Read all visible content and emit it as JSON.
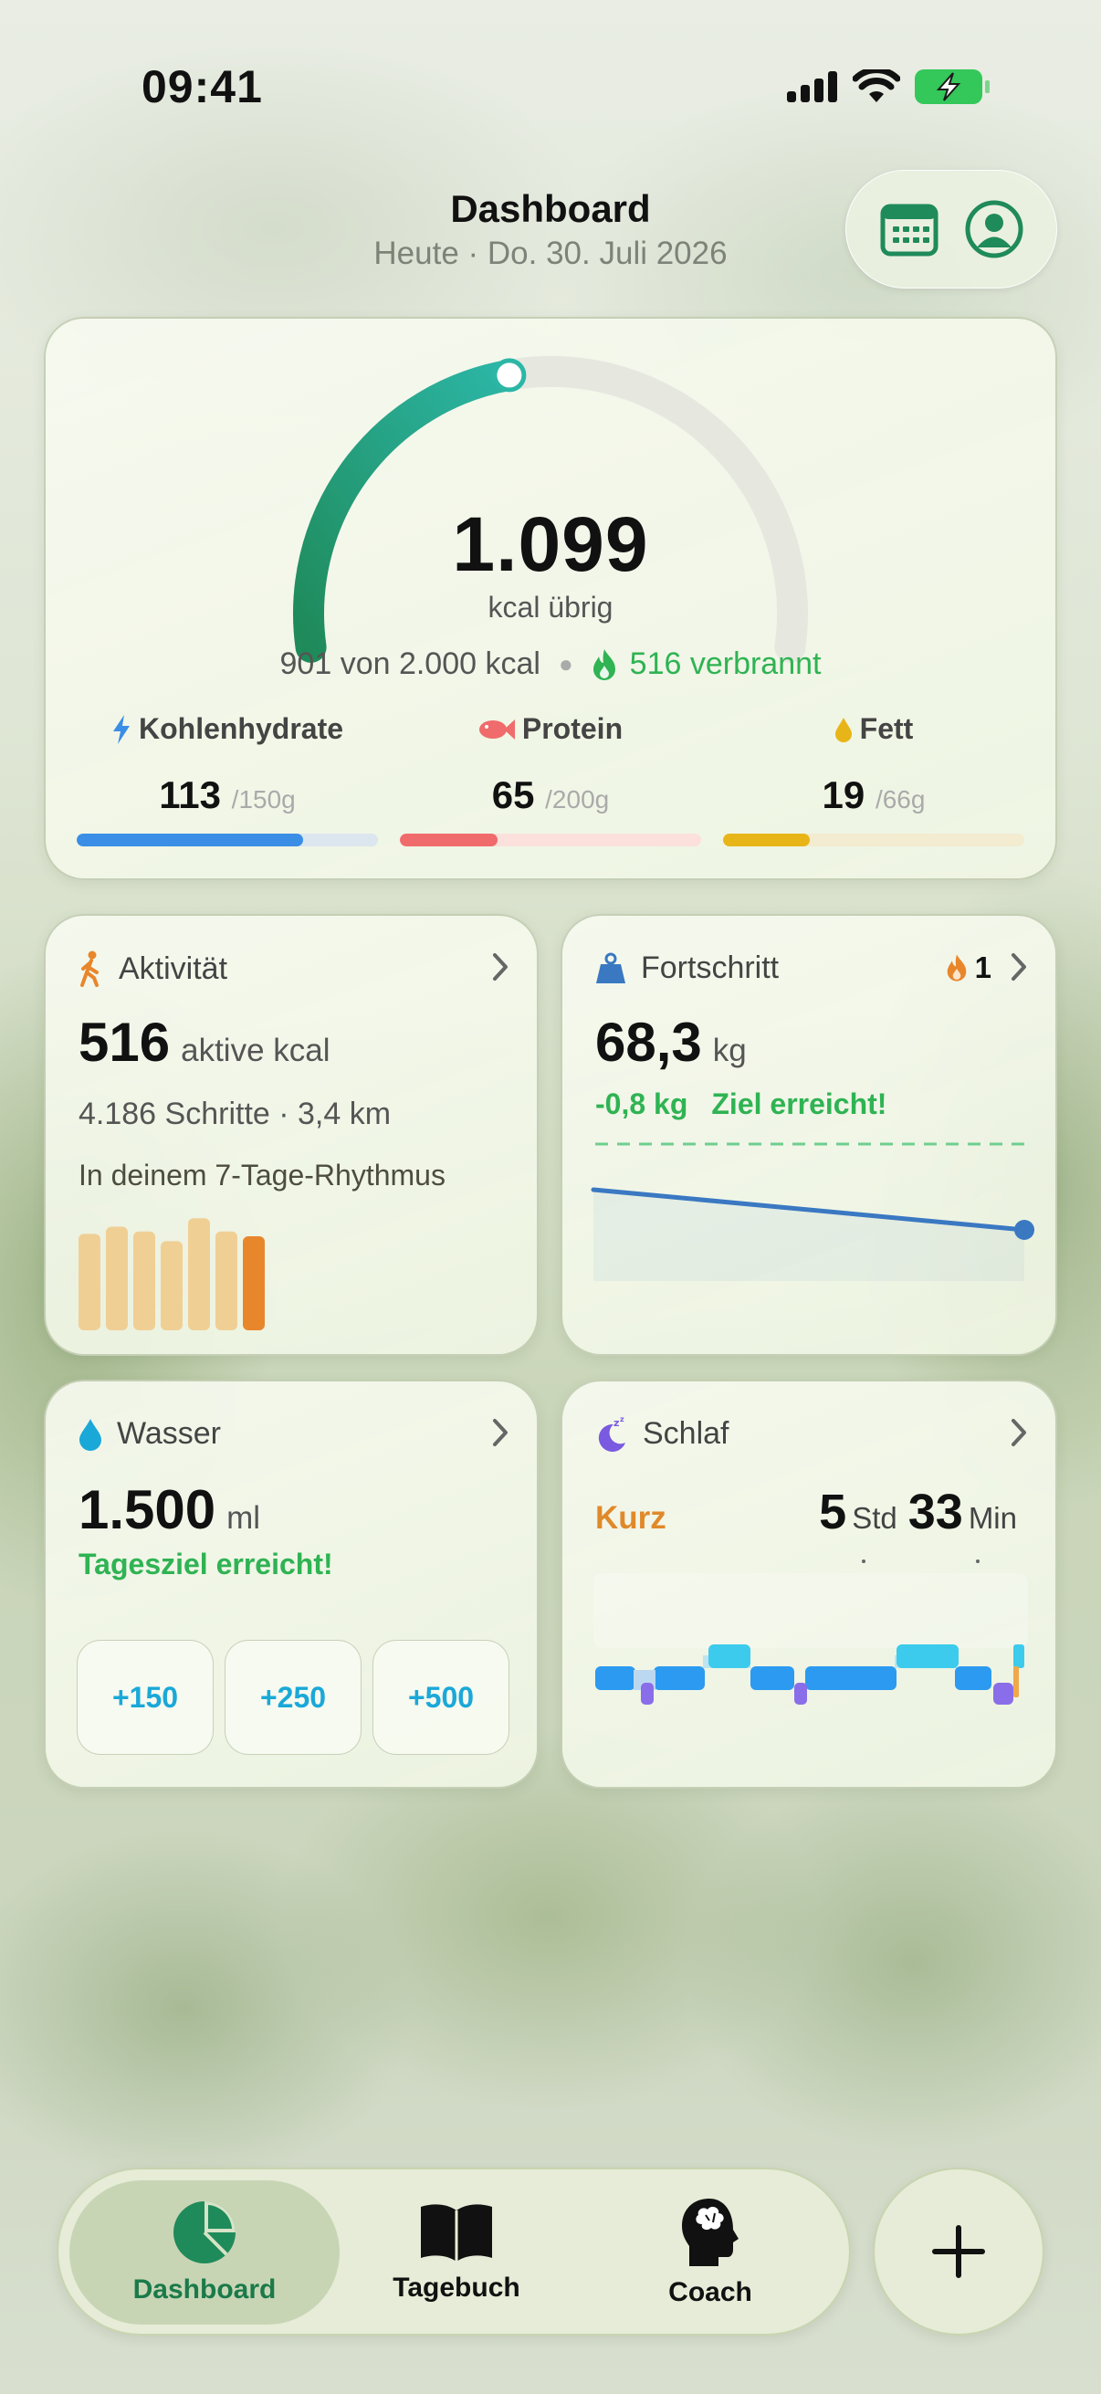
{
  "status_bar": {
    "time": "09:41"
  },
  "header": {
    "title": "Dashboard",
    "subtitle": "Heute · Do. 30. Juli 2026",
    "calendar_icon": "calendar-icon",
    "profile_icon": "profile-icon"
  },
  "calories": {
    "remaining": "1.099",
    "remaining_label": "kcal übrig",
    "consumed_text": "901 von 2.000 kcal",
    "burned_text": "516 verbrannt",
    "progress_fraction": 0.45,
    "colors": {
      "arc_start": "#1f8a5a",
      "arc_end": "#2cb6a6",
      "track": "#e6e8e0"
    }
  },
  "macros": [
    {
      "label": "Kohlenhydrate",
      "value": "113",
      "max": "/150g",
      "fraction": 0.75,
      "color": "#3a8ee6",
      "track": "#dbe6ee",
      "icon": "lightning-icon"
    },
    {
      "label": "Protein",
      "value": "65",
      "max": "/200g",
      "fraction": 0.325,
      "color": "#f06b6b",
      "track": "#fbe0dc",
      "icon": "fish-icon"
    },
    {
      "label": "Fett",
      "value": "19",
      "max": "/66g",
      "fraction": 0.288,
      "color": "#e8b518",
      "track": "#f3ecd0",
      "icon": "drop-icon"
    }
  ],
  "activity": {
    "title": "Aktivität",
    "value": "516",
    "unit": "aktive kcal",
    "steps": "4.186 Schritte · 3,4 km",
    "rhythm": "In deinem 7-Tage-Rhythmus",
    "bars": [
      0.8,
      0.86,
      0.82,
      0.74,
      0.93,
      0.82,
      0.78
    ],
    "colors": {
      "past": "#f0cf95",
      "today": "#e8862c"
    }
  },
  "progress": {
    "title": "Fortschritt",
    "streak": "1",
    "value": "68,3",
    "unit": "kg",
    "delta": "-0,8 kg",
    "goal_text": "Ziel erreicht!",
    "line_color": "#3a78c2"
  },
  "water": {
    "title": "Wasser",
    "value": "1.500",
    "unit": "ml",
    "goal_text": "Tagesziel erreicht!",
    "buttons": [
      "+150",
      "+250",
      "+500"
    ]
  },
  "sleep": {
    "title": "Schlaf",
    "quality": "Kurz",
    "hours": "5",
    "hours_unit": "Std",
    "minutes": "33",
    "minutes_unit": "Min",
    "colors": {
      "core": "#2b9af0",
      "rem": "#3ccbec",
      "deep": "#8a6de8",
      "awake": "#f0a84a"
    }
  },
  "tabs": [
    {
      "label": "Dashboard",
      "icon": "pie-chart-icon",
      "active": true
    },
    {
      "label": "Tagebuch",
      "icon": "book-icon",
      "active": false
    },
    {
      "label": "Coach",
      "icon": "brain-head-icon",
      "active": false
    }
  ],
  "fab_icon": "plus-icon"
}
